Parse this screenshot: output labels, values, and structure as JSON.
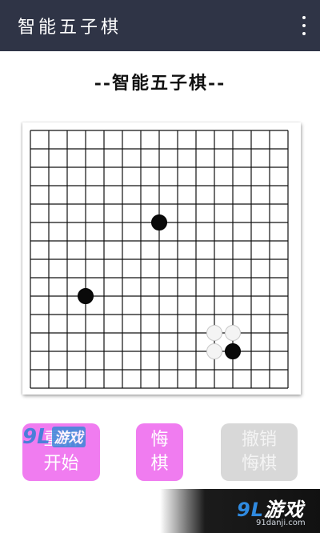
{
  "appbar": {
    "title": "智能五子棋",
    "menu_icon": "overflow-menu-icon"
  },
  "heading": "--智能五子棋--",
  "board": {
    "lines": 15,
    "stones": [
      {
        "color": "black",
        "col": 7,
        "row": 5
      },
      {
        "color": "black",
        "col": 3,
        "row": 9
      },
      {
        "color": "white",
        "col": 10,
        "row": 11
      },
      {
        "color": "white",
        "col": 11,
        "row": 11
      },
      {
        "color": "white",
        "col": 10,
        "row": 12
      },
      {
        "color": "black",
        "col": 11,
        "row": 12
      }
    ]
  },
  "buttons": {
    "restart": "重新\n开始",
    "undo": "悔\n棋",
    "cancel_undo": "撤销\n悔棋"
  },
  "watermark": {
    "left_num": "9L",
    "left_text": "游戏",
    "bottom_num": "9L",
    "bottom_text": "游戏",
    "url": "91danji.com"
  },
  "colors": {
    "appbar": "#2f3446",
    "active_button": "#f07cf0",
    "disabled_button": "#d8d8d8"
  }
}
